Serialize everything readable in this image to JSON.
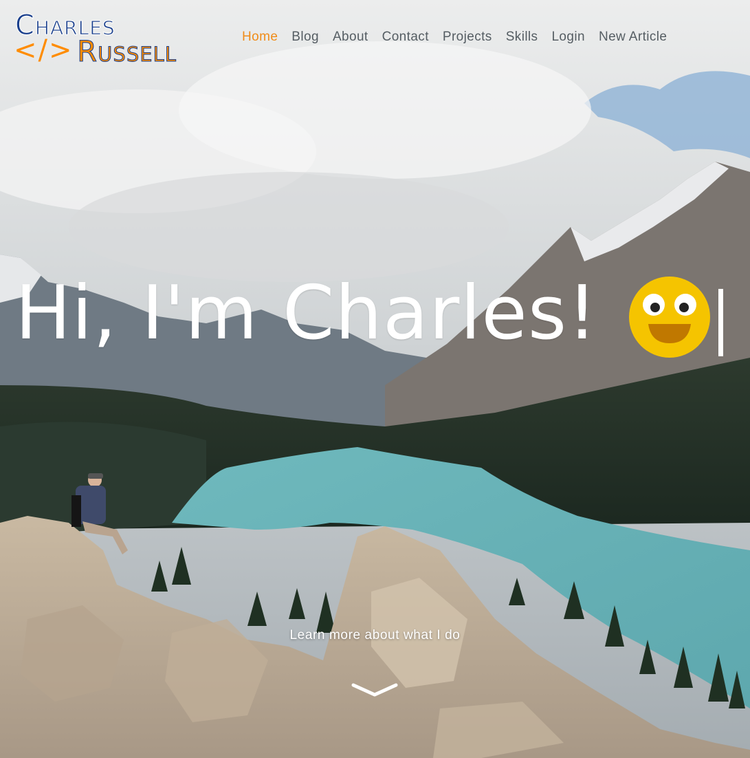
{
  "logo": {
    "first": "Charles",
    "code": "</>",
    "last": "Russell"
  },
  "nav": {
    "items": [
      {
        "label": "Home",
        "active": true
      },
      {
        "label": "Blog"
      },
      {
        "label": "About"
      },
      {
        "label": "Contact"
      },
      {
        "label": "Projects"
      },
      {
        "label": "Skills"
      },
      {
        "label": "Login"
      },
      {
        "label": "New Article"
      }
    ]
  },
  "hero": {
    "heading": "Hi, I'm Charles!",
    "emoji_icon": "grinning-face-icon",
    "learn_more": "Learn more about what I do",
    "scroll_icon": "chevron-down-icon"
  },
  "colors": {
    "nav_active": "#f08c1a",
    "nav_text": "#555d63",
    "logo_blue": "#1a3f8c",
    "logo_orange": "#ff8c00",
    "emoji_yellow": "#f5c400"
  }
}
